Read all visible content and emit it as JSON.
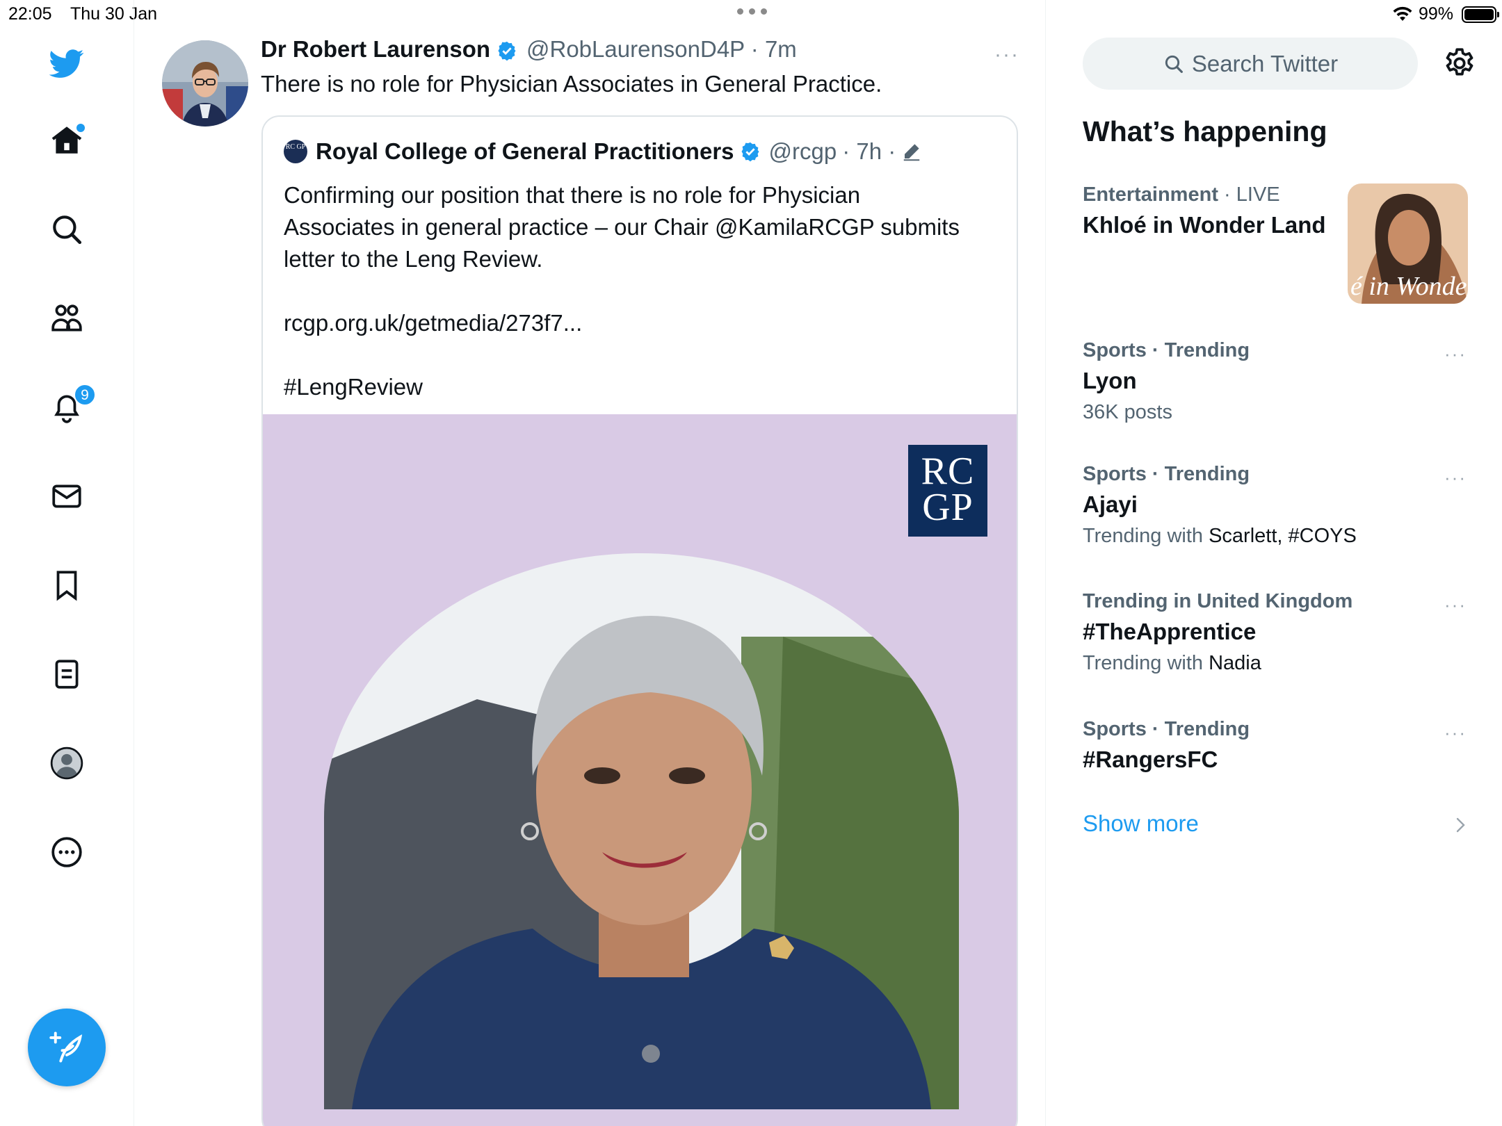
{
  "status_bar": {
    "time": "22:05",
    "date": "Thu 30 Jan",
    "battery": "99%"
  },
  "nav": {
    "notifications_count": "9"
  },
  "tweet": {
    "author_name": "Dr Robert Laurenson",
    "author_handle": "@RobLaurensonD4P",
    "time": "· 7m",
    "text": "There is no role for Physician Associates in General Practice.",
    "more": "···"
  },
  "quote": {
    "logo_text": "RC GP",
    "author_name": "Royal College of General Practitioners",
    "author_handle": "@rcgp",
    "time": "· 7h ·",
    "lines": [
      "Confirming our position that there is no role for Physician",
      "Associates in general practice – our Chair @KamilaRCGP submits",
      "letter to the Leng Review.",
      "",
      "rcgp.org.uk/getmedia/273f7...",
      "",
      "#LengReview"
    ],
    "media_logo": {
      "line1": "RC",
      "line2": "GP"
    }
  },
  "sidebar": {
    "search_placeholder": "Search Twitter",
    "section_title": "What’s happening",
    "trends": [
      {
        "category": "Entertainment",
        "context": "· LIVE",
        "name": "Khloé in Wonder Land",
        "sub_prefix": "",
        "sub_highlight": ""
      },
      {
        "category": "Sports · Trending",
        "context": "",
        "name": "Lyon",
        "sub_prefix": "36K posts",
        "sub_highlight": ""
      },
      {
        "category": "Sports · Trending",
        "context": "",
        "name": "Ajayi",
        "sub_prefix": "Trending with ",
        "sub_highlight": "Scarlett, #COYS"
      },
      {
        "category": "Trending in United Kingdom",
        "context": "",
        "name": "#TheApprentice",
        "sub_prefix": "Trending with ",
        "sub_highlight": "Nadia"
      },
      {
        "category": "Sports · Trending",
        "context": "",
        "name": "#RangersFC",
        "sub_prefix": "",
        "sub_highlight": ""
      }
    ],
    "thumb_caption": "é in Wonder L",
    "show_more": "Show more",
    "trend_more": "···"
  },
  "colors": {
    "accent": "#1d9bf0",
    "media_bg": "#d9cae5",
    "rcgp_navy": "#0d2d5c"
  }
}
